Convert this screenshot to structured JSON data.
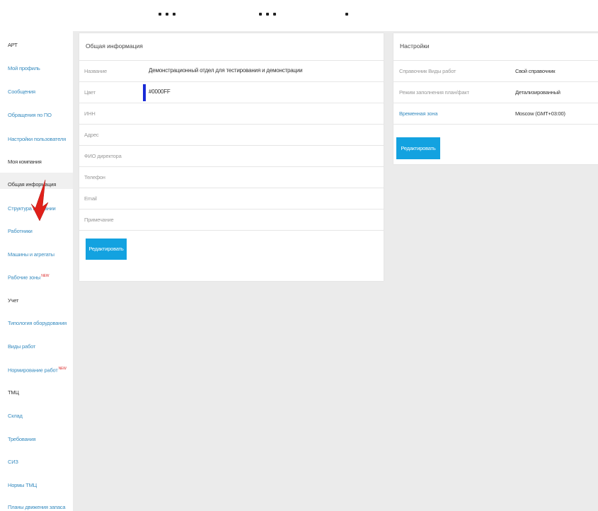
{
  "sidebar": {
    "items": [
      {
        "label": "АРТ",
        "type": "header"
      },
      {
        "label": "Мой профиль",
        "type": "link"
      },
      {
        "label": "Сообщения",
        "type": "link"
      },
      {
        "label": "Обращения по ПО",
        "type": "link"
      },
      {
        "label": "Настройки пользователя",
        "type": "link"
      },
      {
        "label": "Моя компания",
        "type": "header"
      },
      {
        "label": "Общая информация",
        "type": "active"
      },
      {
        "label": "Структура компании",
        "type": "link"
      },
      {
        "label": "Работники",
        "type": "link"
      },
      {
        "label": "Машины и агрегаты",
        "type": "link"
      },
      {
        "label": "Рабочие зоны",
        "type": "link",
        "badge": "NEW"
      },
      {
        "label": "Учет",
        "type": "header"
      },
      {
        "label": "Типология оборудования",
        "type": "link"
      },
      {
        "label": "Виды работ",
        "type": "link"
      },
      {
        "label": "Нормирование работ",
        "type": "link",
        "badge": "NEW"
      },
      {
        "label": "ТМЦ",
        "type": "header"
      },
      {
        "label": "Склад",
        "type": "link"
      },
      {
        "label": "Требования",
        "type": "link"
      },
      {
        "label": "СИЗ",
        "type": "link"
      },
      {
        "label": "Нормы ТМЦ",
        "type": "link"
      },
      {
        "label": "Планы движения запаса",
        "type": "link"
      }
    ]
  },
  "general_info": {
    "title": "Общая информация",
    "rows": [
      {
        "label": "Название",
        "value": "Демонстрационный отдел для тестирования и демонстрации"
      },
      {
        "label": "Цвет",
        "value": "#0000FF",
        "swatch": "#1a2bd6"
      },
      {
        "label": "ИНН",
        "value": ""
      },
      {
        "label": "Адрес",
        "value": ""
      },
      {
        "label": "ФИО директора",
        "value": ""
      },
      {
        "label": "Телефон",
        "value": ""
      },
      {
        "label": "Email",
        "value": ""
      },
      {
        "label": "Примечание",
        "value": ""
      }
    ],
    "edit_label": "Редактировать"
  },
  "settings": {
    "title": "Настройки",
    "rows": [
      {
        "label": "Справочник Виды работ",
        "value": "Свой справочник",
        "link": false
      },
      {
        "label": "Режим заполнения план/факт",
        "value": "Детализированный",
        "link": false
      },
      {
        "label": "Временная зона",
        "value": "Moscow (GMT+03:00)",
        "link": true
      }
    ],
    "edit_label": "Редактировать"
  },
  "colors": {
    "accent": "#13a2e0",
    "link": "#3a8dc0",
    "background": "#ebebeb",
    "cursor": "#e0201a"
  },
  "icons": {
    "cursor": "arrow-cursor-icon"
  }
}
